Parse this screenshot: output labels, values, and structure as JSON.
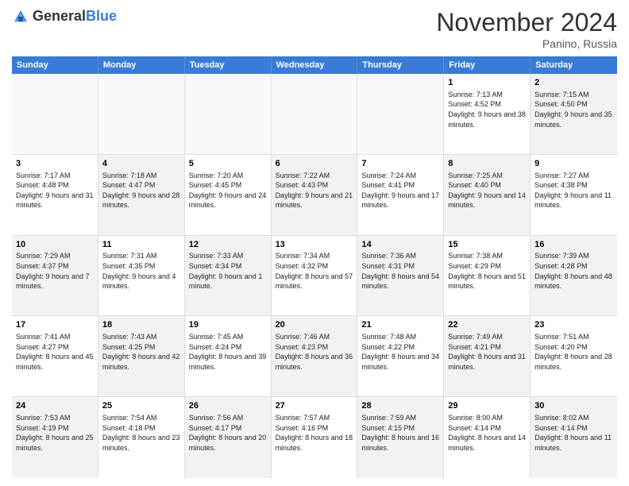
{
  "header": {
    "logo_general": "General",
    "logo_blue": "Blue",
    "month_title": "November 2024",
    "location": "Panino, Russia"
  },
  "days_of_week": [
    "Sunday",
    "Monday",
    "Tuesday",
    "Wednesday",
    "Thursday",
    "Friday",
    "Saturday"
  ],
  "weeks": [
    [
      {
        "day": "",
        "text": "",
        "empty": true
      },
      {
        "day": "",
        "text": "",
        "empty": true
      },
      {
        "day": "",
        "text": "",
        "empty": true
      },
      {
        "day": "",
        "text": "",
        "empty": true
      },
      {
        "day": "",
        "text": "",
        "empty": true
      },
      {
        "day": "1",
        "text": "Sunrise: 7:13 AM\nSunset: 4:52 PM\nDaylight: 9 hours\nand 38 minutes.",
        "empty": false
      },
      {
        "day": "2",
        "text": "Sunrise: 7:15 AM\nSunset: 4:50 PM\nDaylight: 9 hours\nand 35 minutes.",
        "empty": false,
        "shaded": true
      }
    ],
    [
      {
        "day": "3",
        "text": "Sunrise: 7:17 AM\nSunset: 4:48 PM\nDaylight: 9 hours\nand 31 minutes.",
        "empty": false
      },
      {
        "day": "4",
        "text": "Sunrise: 7:18 AM\nSunset: 4:47 PM\nDaylight: 9 hours\nand 28 minutes.",
        "empty": false,
        "shaded": true
      },
      {
        "day": "5",
        "text": "Sunrise: 7:20 AM\nSunset: 4:45 PM\nDaylight: 9 hours\nand 24 minutes.",
        "empty": false
      },
      {
        "day": "6",
        "text": "Sunrise: 7:22 AM\nSunset: 4:43 PM\nDaylight: 9 hours\nand 21 minutes.",
        "empty": false,
        "shaded": true
      },
      {
        "day": "7",
        "text": "Sunrise: 7:24 AM\nSunset: 4:41 PM\nDaylight: 9 hours\nand 17 minutes.",
        "empty": false
      },
      {
        "day": "8",
        "text": "Sunrise: 7:25 AM\nSunset: 4:40 PM\nDaylight: 9 hours\nand 14 minutes.",
        "empty": false,
        "shaded": true
      },
      {
        "day": "9",
        "text": "Sunrise: 7:27 AM\nSunset: 4:38 PM\nDaylight: 9 hours\nand 11 minutes.",
        "empty": false
      }
    ],
    [
      {
        "day": "10",
        "text": "Sunrise: 7:29 AM\nSunset: 4:37 PM\nDaylight: 9 hours\nand 7 minutes.",
        "empty": false,
        "shaded": true
      },
      {
        "day": "11",
        "text": "Sunrise: 7:31 AM\nSunset: 4:35 PM\nDaylight: 9 hours\nand 4 minutes.",
        "empty": false
      },
      {
        "day": "12",
        "text": "Sunrise: 7:33 AM\nSunset: 4:34 PM\nDaylight: 9 hours\nand 1 minute.",
        "empty": false,
        "shaded": true
      },
      {
        "day": "13",
        "text": "Sunrise: 7:34 AM\nSunset: 4:32 PM\nDaylight: 8 hours\nand 57 minutes.",
        "empty": false
      },
      {
        "day": "14",
        "text": "Sunrise: 7:36 AM\nSunset: 4:31 PM\nDaylight: 8 hours\nand 54 minutes.",
        "empty": false,
        "shaded": true
      },
      {
        "day": "15",
        "text": "Sunrise: 7:38 AM\nSunset: 4:29 PM\nDaylight: 8 hours\nand 51 minutes.",
        "empty": false
      },
      {
        "day": "16",
        "text": "Sunrise: 7:39 AM\nSunset: 4:28 PM\nDaylight: 8 hours\nand 48 minutes.",
        "empty": false,
        "shaded": true
      }
    ],
    [
      {
        "day": "17",
        "text": "Sunrise: 7:41 AM\nSunset: 4:27 PM\nDaylight: 8 hours\nand 45 minutes.",
        "empty": false
      },
      {
        "day": "18",
        "text": "Sunrise: 7:43 AM\nSunset: 4:25 PM\nDaylight: 8 hours\nand 42 minutes.",
        "empty": false,
        "shaded": true
      },
      {
        "day": "19",
        "text": "Sunrise: 7:45 AM\nSunset: 4:24 PM\nDaylight: 8 hours\nand 39 minutes.",
        "empty": false
      },
      {
        "day": "20",
        "text": "Sunrise: 7:46 AM\nSunset: 4:23 PM\nDaylight: 8 hours\nand 36 minutes.",
        "empty": false,
        "shaded": true
      },
      {
        "day": "21",
        "text": "Sunrise: 7:48 AM\nSunset: 4:22 PM\nDaylight: 8 hours\nand 34 minutes.",
        "empty": false
      },
      {
        "day": "22",
        "text": "Sunrise: 7:49 AM\nSunset: 4:21 PM\nDaylight: 8 hours\nand 31 minutes.",
        "empty": false,
        "shaded": true
      },
      {
        "day": "23",
        "text": "Sunrise: 7:51 AM\nSunset: 4:20 PM\nDaylight: 8 hours\nand 28 minutes.",
        "empty": false
      }
    ],
    [
      {
        "day": "24",
        "text": "Sunrise: 7:53 AM\nSunset: 4:19 PM\nDaylight: 8 hours\nand 25 minutes.",
        "empty": false,
        "shaded": true
      },
      {
        "day": "25",
        "text": "Sunrise: 7:54 AM\nSunset: 4:18 PM\nDaylight: 8 hours\nand 23 minutes.",
        "empty": false
      },
      {
        "day": "26",
        "text": "Sunrise: 7:56 AM\nSunset: 4:17 PM\nDaylight: 8 hours\nand 20 minutes.",
        "empty": false,
        "shaded": true
      },
      {
        "day": "27",
        "text": "Sunrise: 7:57 AM\nSunset: 4:16 PM\nDaylight: 8 hours\nand 18 minutes.",
        "empty": false
      },
      {
        "day": "28",
        "text": "Sunrise: 7:59 AM\nSunset: 4:15 PM\nDaylight: 8 hours\nand 16 minutes.",
        "empty": false,
        "shaded": true
      },
      {
        "day": "29",
        "text": "Sunrise: 8:00 AM\nSunset: 4:14 PM\nDaylight: 8 hours\nand 14 minutes.",
        "empty": false
      },
      {
        "day": "30",
        "text": "Sunrise: 8:02 AM\nSunset: 4:14 PM\nDaylight: 8 hours\nand 11 minutes.",
        "empty": false,
        "shaded": true
      }
    ]
  ]
}
